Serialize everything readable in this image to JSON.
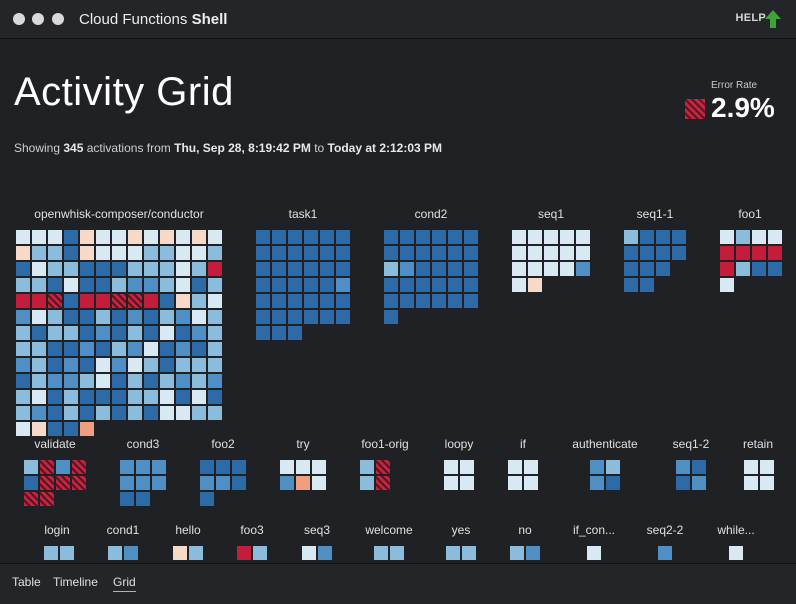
{
  "window": {
    "title_prefix": "Cloud Functions",
    "title_strong": "Shell"
  },
  "header": {
    "help": "HELP",
    "help_icon": "up-arrow-icon",
    "help_color": "#3fa23a"
  },
  "page": {
    "title": "Activity Grid",
    "error_rate_label": "Error Rate",
    "error_rate": "2.9%",
    "summary": {
      "showing": "Showing",
      "count": "345",
      "activations_from": "activations from",
      "start": "Thu, Sep 28, 8:19:42 PM",
      "to": "to",
      "end": "Today at 2:12:03 PM"
    }
  },
  "legend_colors": {
    "fast": "#2d6aa8",
    "medium": "#4f8fc4",
    "slow": "#8bbcdc",
    "very_slow": "#d8e9f3",
    "warn_light": "#f6d9c7",
    "warn": "#ef9f80",
    "error": "#c41d3c"
  },
  "groups": [
    {
      "name": "openwhisk-composer/conductor",
      "cols": 13,
      "cells": "4441l44l4l4l4|l331l44433c43|1433111333c3r|3314113223413|rrh1rrhhr1l34|2c311312132c3|3133121314123|3311213241213|2312142c31333|1322341313232|3413111334141|3213131314c33|4l11o"
    },
    {
      "name": "task1",
      "cols": 6,
      "cells": "111111|111111|111111|111112|111111|111111|111"
    },
    {
      "name": "cond2",
      "cols": 6,
      "cells": "111111|111111|321111|111111|111111|1"
    },
    {
      "name": "seq1",
      "cols": 5,
      "cells": "44444|44444|44442|4l"
    },
    {
      "name": "seq1-1",
      "cols": 4,
      "cells": "3111|1111|111|11"
    },
    {
      "name": "foo1",
      "cols": 4,
      "cells": "4344|rrrr|r311|4"
    },
    {
      "name": "validate",
      "cols": 4,
      "cells": "3h2h|1hhh|hh",
      "loose": 1
    },
    {
      "name": "cond3",
      "cols": 3,
      "cells": "222|222|11"
    },
    {
      "name": "foo2",
      "cols": 3,
      "cells": "111|221|1"
    },
    {
      "name": "try",
      "cols": 3,
      "cells": "444|2o4"
    },
    {
      "name": "foo1-orig",
      "cols": 2,
      "cells": "3h|3h"
    },
    {
      "name": "loopy",
      "cols": 2,
      "cells": "44|44"
    },
    {
      "name": "if",
      "cols": 2,
      "cells": "44|44"
    },
    {
      "name": "authenticate",
      "cols": 2,
      "cells": "23|21"
    },
    {
      "name": "seq1-2",
      "cols": 2,
      "cells": "21|12"
    },
    {
      "name": "retain",
      "cols": 2,
      "cells": "44|44"
    },
    {
      "name": "login",
      "cols": 2,
      "cells": "33"
    },
    {
      "name": "cond1",
      "cols": 2,
      "cells": "32"
    },
    {
      "name": "hello",
      "cols": 2,
      "cells": "l3"
    },
    {
      "name": "foo3",
      "cols": 2,
      "cells": "r3"
    },
    {
      "name": "seq3",
      "cols": 2,
      "cells": "42"
    },
    {
      "name": "welcome",
      "cols": 2,
      "cells": "33"
    },
    {
      "name": "yes",
      "cols": 2,
      "cells": "33"
    },
    {
      "name": "no",
      "cols": 2,
      "cells": "32"
    },
    {
      "name": "if_con...",
      "cols": 1,
      "cells": "4"
    },
    {
      "name": "seq2-2",
      "cols": 1,
      "cells": "2"
    },
    {
      "name": "while...",
      "cols": 1,
      "cells": "4"
    }
  ],
  "tabs": [
    "Table",
    "Timeline",
    "Grid"
  ],
  "active_tab": "Grid"
}
